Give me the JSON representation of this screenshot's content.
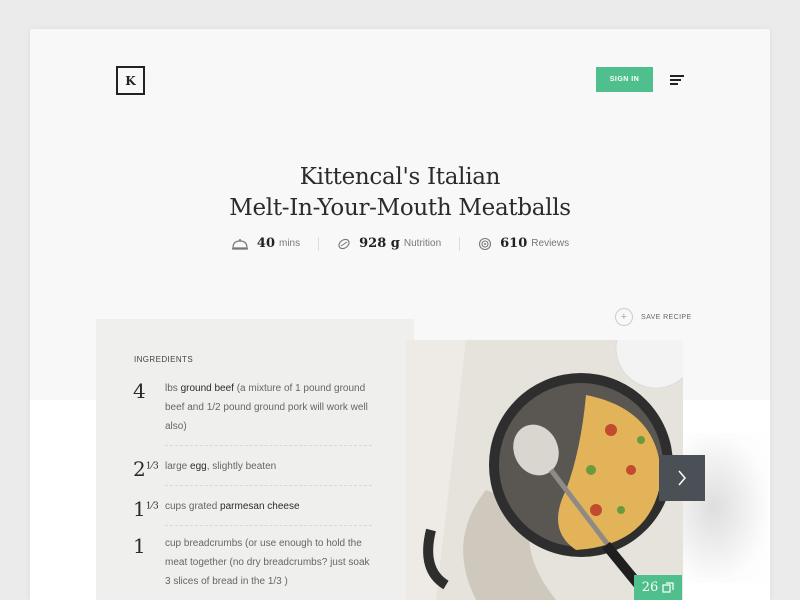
{
  "header": {
    "logo_letter": "K",
    "signin_label": "SIGN IN"
  },
  "recipe": {
    "title_line1": "Kittencal's Italian",
    "title_line2": "Melt-In-Your-Mouth Meatballs",
    "meta": [
      {
        "icon": "cloche-icon",
        "value": "40",
        "label": "mins"
      },
      {
        "icon": "nutrition-icon",
        "value": "928 g",
        "label": "Nutrition"
      },
      {
        "icon": "reviews-icon",
        "value": "610",
        "label": "Reviews"
      }
    ],
    "save_label": "SAVE RECIPE"
  },
  "ingredients": {
    "heading": "INGREDIENTS",
    "items": [
      {
        "qty": "4",
        "qty_frac": "",
        "pre": "lbs ",
        "bold": "ground beef",
        "post": " (a mixture of 1 pound ground beef and 1/2 pound ground pork will work well also)"
      },
      {
        "qty": "2",
        "qty_frac": "1⁄3",
        "pre": "large ",
        "bold": "egg",
        "post": ", slightly beaten"
      },
      {
        "qty": "1",
        "qty_frac": "1⁄3",
        "pre": "cups grated ",
        "bold": "parmesan cheese",
        "post": ""
      },
      {
        "qty": "1",
        "qty_frac": "",
        "pre": "cup breadcrumbs (or use enough to hold the meat together (no dry breadcrumbs? just soak 3 slices of bread in the 1/3 )",
        "bold": "",
        "post": ""
      }
    ]
  },
  "gallery": {
    "count": "26",
    "next_icon": "chevron-right-icon",
    "count_icon": "gallery-icon"
  },
  "colors": {
    "accent": "#4fc08d",
    "dark_button": "#4a5055"
  }
}
